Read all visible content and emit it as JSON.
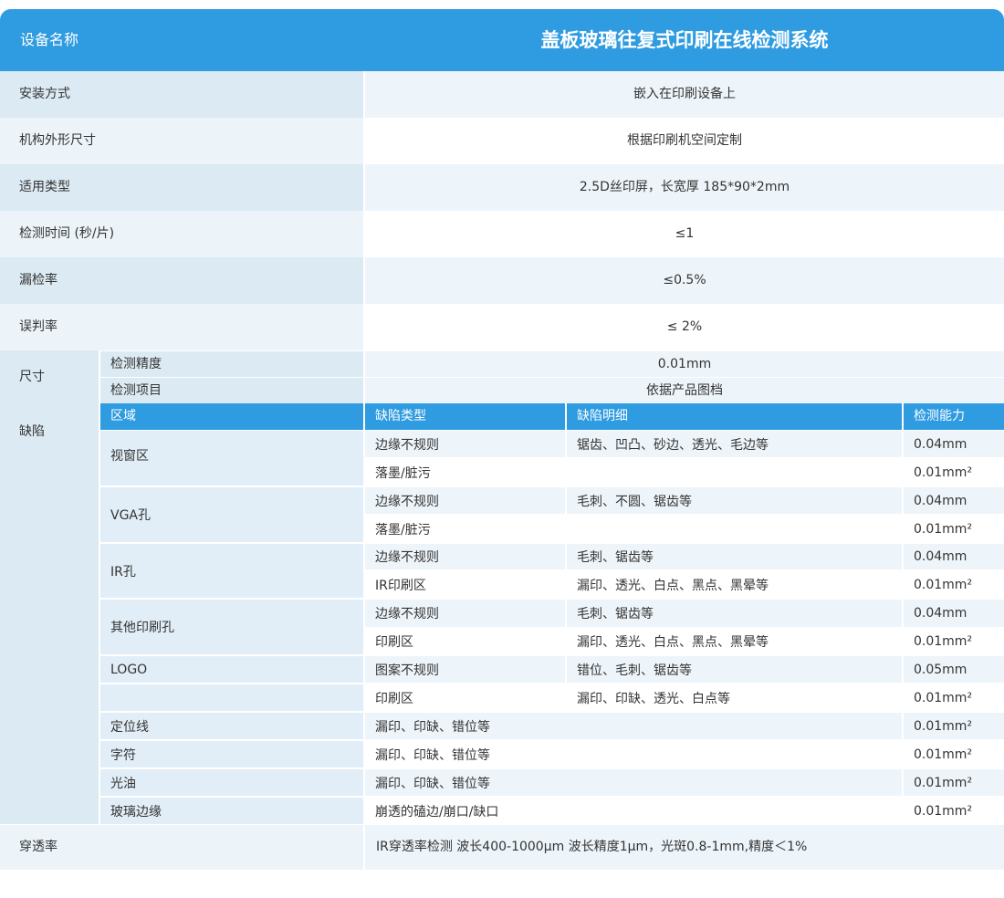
{
  "header": {
    "label": "设备名称",
    "title": "盖板玻璃往复式印刷在线检测系统"
  },
  "specs": [
    {
      "label": "安装方式",
      "value": "嵌入在印刷设备上"
    },
    {
      "label": "机构外形尺寸",
      "value": "根据印刷机空间定制"
    },
    {
      "label": "适用类型",
      "value": "2.5D丝印屏，长宽厚 185*90*2mm"
    },
    {
      "label": "检测时间 (秒/片)",
      "value": "≤1"
    },
    {
      "label": "漏检率",
      "value": "≤0.5%"
    },
    {
      "label": "误判率",
      "value": "≤ 2%"
    }
  ],
  "size": {
    "label": "尺寸",
    "rows": [
      {
        "name": "检测精度",
        "value": "0.01mm"
      },
      {
        "name": "检测项目",
        "value": "依据产品图档"
      }
    ]
  },
  "defects": {
    "label": "缺陷",
    "headers": [
      "区域",
      "缺陷类型",
      "缺陷明细",
      "检测能力"
    ],
    "groups": [
      {
        "zone": "视窗区",
        "rows": [
          {
            "type": "边缘不规则",
            "detail": "锯齿、凹凸、砂边、透光、毛边等",
            "capability": "0.04mm"
          },
          {
            "type": "落墨/脏污",
            "detail": "",
            "capability": "0.01mm²"
          }
        ]
      },
      {
        "zone": "VGA孔",
        "rows": [
          {
            "type": "边缘不规则",
            "detail": "毛刺、不圆、锯齿等",
            "capability": "0.04mm"
          },
          {
            "type": "落墨/脏污",
            "detail": "",
            "capability": "0.01mm²"
          }
        ]
      },
      {
        "zone": "IR孔",
        "rows": [
          {
            "type": "边缘不规则",
            "detail": "毛刺、锯齿等",
            "capability": "0.04mm"
          },
          {
            "type": "IR印刷区",
            "detail": "漏印、透光、白点、黑点、黑晕等",
            "capability": "0.01mm²"
          }
        ]
      },
      {
        "zone": "其他印刷孔",
        "rows": [
          {
            "type": "边缘不规则",
            "detail": "毛刺、锯齿等",
            "capability": "0.04mm"
          },
          {
            "type": "印刷区",
            "detail": "漏印、透光、白点、黑点、黑晕等",
            "capability": "0.01mm²"
          }
        ]
      }
    ],
    "logo_rows": [
      {
        "zone": "LOGO",
        "type": "图案不规则",
        "detail": "错位、毛刺、锯齿等",
        "capability": "0.05mm"
      },
      {
        "zone": "",
        "type": "印刷区",
        "detail": "漏印、印缺、透光、白点等",
        "capability": "0.01mm²"
      }
    ],
    "wide_rows": [
      {
        "zone": "定位线",
        "detail": "漏印、印缺、错位等",
        "capability": "0.01mm²"
      },
      {
        "zone": "字符",
        "detail": "漏印、印缺、错位等",
        "capability": "0.01mm²"
      },
      {
        "zone": "光油",
        "detail": "漏印、印缺、错位等",
        "capability": "0.01mm²"
      },
      {
        "zone": "玻璃边缘",
        "detail": "崩透的磕边/崩口/缺口",
        "capability": "0.01mm²"
      }
    ]
  },
  "transmittance": {
    "label": "穿透率",
    "value": "IR穿透率检测 波长400-1000μm 波长精度1μm，光斑0.8-1mm,精度＜1%"
  }
}
